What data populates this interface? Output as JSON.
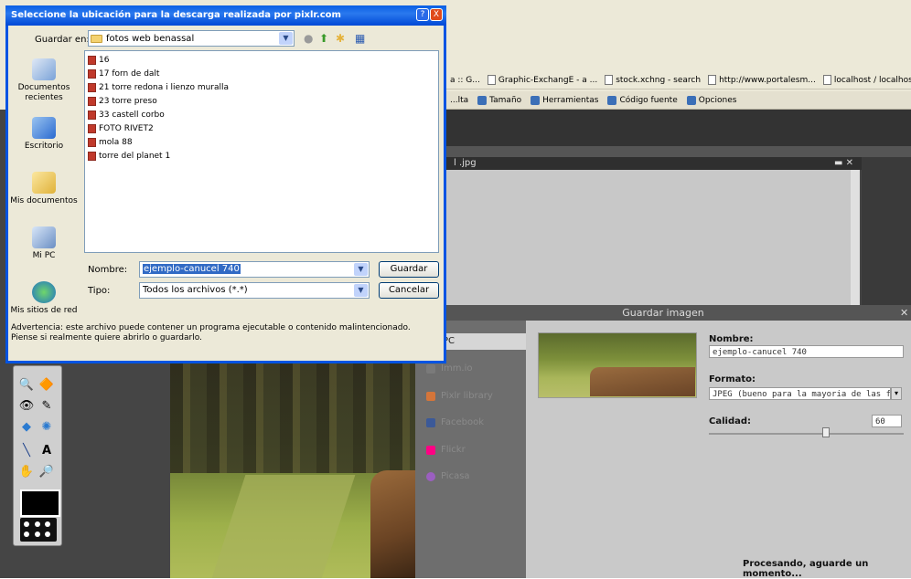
{
  "browser": {
    "bookmarks": [
      "a :: G...",
      "Graphic-ExchangE - a ...",
      "stock.xchng - search",
      "http://www.portalesm...",
      "localhost / localhost | ..."
    ],
    "toolbar": [
      "...lta",
      "Tamaño",
      "Herramientas",
      "Código fuente",
      "Opciones"
    ]
  },
  "editor": {
    "doc_title": "l .jpg",
    "doc_controls": "▬ ✕"
  },
  "save_dialog": {
    "title": "Guardar imagen",
    "close": "✕",
    "options": [
      {
        "label": "l PC",
        "color": "#cccccc"
      },
      {
        "label": "Imm.io",
        "color": "#7a7a7a"
      },
      {
        "label": "Pixlr library",
        "color": "#d4753a"
      },
      {
        "label": "Facebook",
        "color": "#3b5998"
      },
      {
        "label": "Flickr",
        "color": "#ff0084"
      },
      {
        "label": "Picasa",
        "color": "#9b5fc0"
      }
    ],
    "name_label": "Nombre:",
    "name_value": "ejemplo-canucel 740",
    "format_label": "Formato:",
    "format_value": "JPEG (bueno para la mayoria de las foto",
    "quality_label": "Calidad:",
    "quality_value": "60",
    "quality_fraction": 0.6,
    "processing": "Procesando, aguarde un momento..."
  },
  "xp_dialog": {
    "title": "Seleccione la ubicación para la descarga realizada por pixlr.com",
    "help": "?",
    "close": "X",
    "save_in_label": "Guardar en:",
    "location": "fotos web benassal",
    "places": [
      "Documentos recientes",
      "Escritorio",
      "Mis documentos",
      "Mi PC",
      "Mis sitios de red"
    ],
    "files": [
      "16",
      "17 forn de dalt",
      "21 torre redona i lienzo muralla",
      "23 torre preso",
      "33 castell corbo",
      "FOTO RIVET2",
      "mola 88",
      "torre del planet 1"
    ],
    "name_label": "Nombre:",
    "name_value": "ejemplo-canucel 740",
    "type_label": "Tipo:",
    "type_value": "Todos los archivos (*.*)",
    "save_button": "Guardar",
    "cancel_button": "Cancelar",
    "warning_line1": "Advertencia: este archivo puede contener un programa ejecutable o contenido malintencionado.",
    "warning_line2": "Piense si realmente quiere abrirlo o guardarlo."
  }
}
